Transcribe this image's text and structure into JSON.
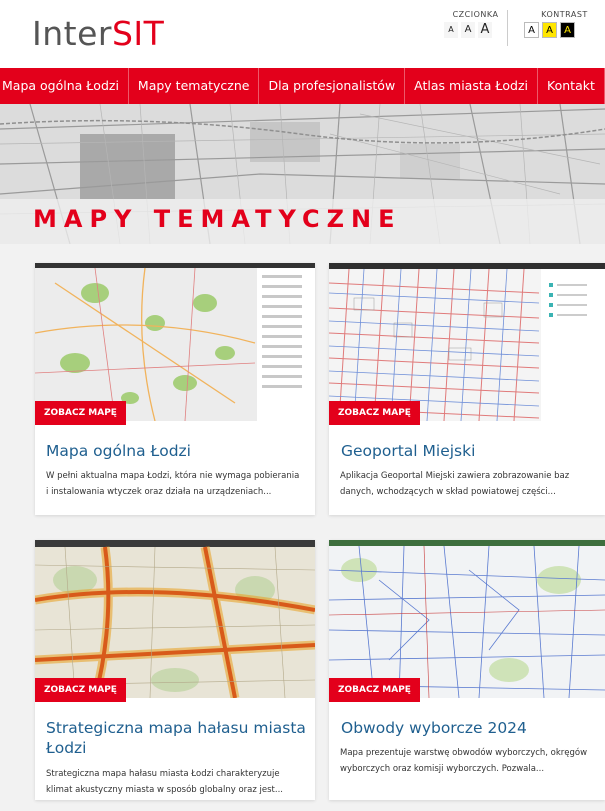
{
  "logo": {
    "part1": "Inter",
    "part2": "SIT"
  },
  "accessibility": {
    "font_label": "CZCIONKA",
    "font_buttons": [
      "A",
      "A",
      "A"
    ],
    "contrast_label": "KONTRAST",
    "contrast_buttons": [
      "A",
      "A",
      "A"
    ]
  },
  "nav": {
    "items": [
      {
        "label": "Mapa ogólna Łodzi"
      },
      {
        "label": "Mapy tematyczne"
      },
      {
        "label": "Dla profesjonalistów"
      },
      {
        "label": "Atlas miasta Łodzi"
      },
      {
        "label": "Kontakt"
      }
    ]
  },
  "hero": {
    "title": "MAPY TEMATYCZNE"
  },
  "cards": [
    {
      "badge": "ZOBACZ MAPĘ",
      "title": "Mapa ogólna Łodzi",
      "desc1": "W pełni aktualna mapa Łodzi, która nie wymaga pobierania",
      "desc2": "i instalowania wtyczek oraz działa na urządzeniach..."
    },
    {
      "badge": "ZOBACZ MAPĘ",
      "title": "Geoportal Miejski",
      "desc1": "Aplikacja Geoportal Miejski zawiera zobrazowanie baz",
      "desc2": "danych, wchodzących w skład powiatowej części..."
    },
    {
      "badge": "ZOBACZ MAPĘ",
      "title1": "Strategiczna mapa hałasu miasta",
      "title2": "Łodzi",
      "desc1": "Strategiczna mapa hałasu miasta Łodzi charakteryzuje",
      "desc2": "klimat akustyczny miasta w sposób globalny oraz jest..."
    },
    {
      "badge": "ZOBACZ MAPĘ",
      "title": "Obwody wyborcze 2024",
      "desc1": "Mapa prezentuje warstwę obwodów wyborczych, okręgów",
      "desc2": "wyborczych oraz komisji wyborczych. Pozwala..."
    }
  ],
  "colors": {
    "brand_red": "#e3001b",
    "title_blue": "#1f5f8f",
    "logo_gray": "#555555"
  }
}
